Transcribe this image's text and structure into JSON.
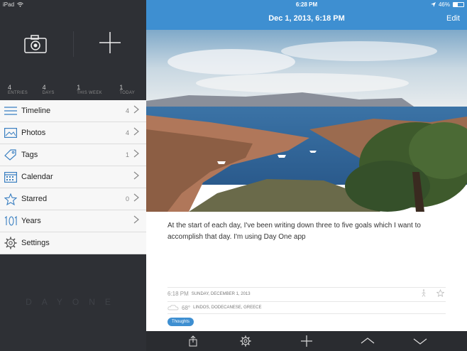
{
  "status": {
    "device": "iPad",
    "time": "6:28 PM",
    "battery": "46%",
    "battery_level": 0.46
  },
  "sidebar": {
    "stats": [
      {
        "value": "4",
        "label": "ENTRIES"
      },
      {
        "value": "4",
        "label": "DAYS"
      },
      {
        "value": "1",
        "label": "THIS WEEK"
      },
      {
        "value": "1",
        "label": "TODAY"
      }
    ],
    "items": [
      {
        "label": "Timeline",
        "count": "4",
        "icon": "timeline-icon"
      },
      {
        "label": "Photos",
        "count": "4",
        "icon": "photos-icon"
      },
      {
        "label": "Tags",
        "count": "1",
        "icon": "tag-icon"
      },
      {
        "label": "Calendar",
        "count": "",
        "icon": "calendar-icon"
      },
      {
        "label": "Starred",
        "count": "0",
        "icon": "star-icon"
      },
      {
        "label": "Years",
        "count": "",
        "icon": "years-icon"
      },
      {
        "label": "Settings",
        "count": "",
        "icon": "gear-icon"
      }
    ],
    "logo": "DAYONE"
  },
  "entry": {
    "title": "Dec 1, 2013, 6:18 PM",
    "edit_label": "Edit",
    "text": "At the start of each day, I've been writing down three to five goals which I want to accomplish that day. I'm using Day One app",
    "time": "6:18 PM",
    "date": "SUNDAY, DECEMBER 1, 2013",
    "temperature": "68°",
    "location": "LINDOS, DODECANESE, GREECE",
    "tag": "Thoughts"
  },
  "colors": {
    "accent": "#3e8fd1",
    "sidebar_bg": "#2e3035"
  }
}
